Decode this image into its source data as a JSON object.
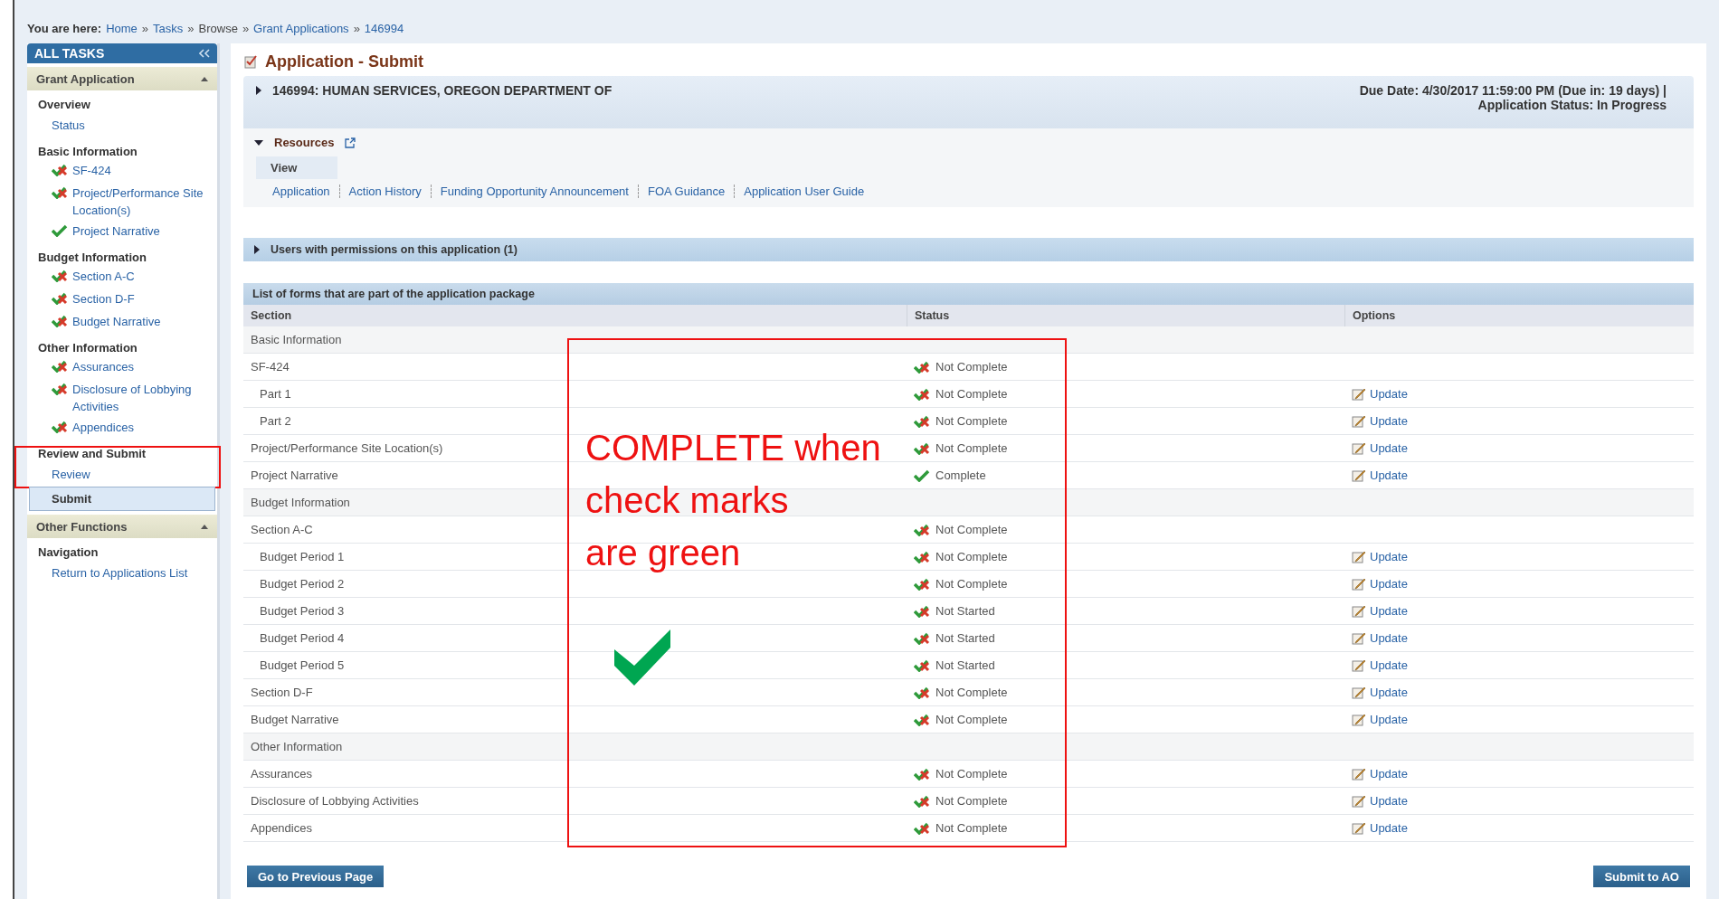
{
  "breadcrumb": {
    "label": "You are here:",
    "separator": "»",
    "items": [
      {
        "text": "Home",
        "link": true
      },
      {
        "text": "Tasks",
        "link": true
      },
      {
        "text": "Browse",
        "link": false
      },
      {
        "text": "Grant Applications",
        "link": true
      },
      {
        "text": "146994",
        "link": true
      }
    ]
  },
  "sidebar": {
    "title": "ALL TASKS",
    "groups": [
      {
        "title": "Grant Application",
        "expanded": true,
        "sections": [
          {
            "heading": "Overview",
            "items": [
              {
                "label": "Status",
                "kind": "link",
                "selected": false,
                "highlighted": false
              }
            ]
          },
          {
            "heading": "Basic Information",
            "items": [
              {
                "label": "SF-424",
                "kind": "form",
                "complete": false,
                "selected": false,
                "highlighted": false
              },
              {
                "label": "Project/Performance Site Location(s)",
                "kind": "form",
                "complete": false,
                "selected": false,
                "highlighted": false
              },
              {
                "label": "Project Narrative",
                "kind": "form",
                "complete": true,
                "selected": false,
                "highlighted": false
              }
            ]
          },
          {
            "heading": "Budget Information",
            "items": [
              {
                "label": "Section A-C",
                "kind": "form",
                "complete": false,
                "selected": false,
                "highlighted": false
              },
              {
                "label": "Section D-F",
                "kind": "form",
                "complete": false,
                "selected": false,
                "highlighted": false
              },
              {
                "label": "Budget Narrative",
                "kind": "form",
                "complete": false,
                "selected": false,
                "highlighted": false
              }
            ]
          },
          {
            "heading": "Other Information",
            "items": [
              {
                "label": "Assurances",
                "kind": "form",
                "complete": false,
                "selected": false,
                "highlighted": false
              },
              {
                "label": "Disclosure of Lobbying Activities",
                "kind": "form",
                "complete": false,
                "selected": false,
                "highlighted": false
              },
              {
                "label": "Appendices",
                "kind": "form",
                "complete": false,
                "selected": false,
                "highlighted": false
              }
            ]
          },
          {
            "heading": "Review and Submit",
            "items": [
              {
                "label": "Review",
                "kind": "link",
                "selected": false,
                "highlighted": true
              },
              {
                "label": "Submit",
                "kind": "link",
                "selected": true,
                "highlighted": false
              }
            ]
          }
        ]
      },
      {
        "title": "Other Functions",
        "expanded": true,
        "sections": [
          {
            "heading": "Navigation",
            "items": [
              {
                "label": "Return to Applications List",
                "kind": "link",
                "selected": false,
                "highlighted": false
              }
            ]
          }
        ]
      }
    ]
  },
  "page_title": "Application - Submit",
  "application": {
    "name": "146994: HUMAN SERVICES, OREGON DEPARTMENT OF",
    "due_date": "Due Date: 4/30/2017 11:59:00 PM (Due in: 19 days) |",
    "status": "Application Status: In Progress",
    "expanded": false
  },
  "resources": {
    "title": "Resources",
    "expanded": true,
    "tab": "View",
    "links": [
      "Application",
      "Action History",
      "Funding Opportunity Announcement",
      "FOA Guidance",
      "Application User Guide"
    ]
  },
  "users_panel": {
    "title": "Users with permissions on this application (1)",
    "expanded": false
  },
  "forms": {
    "title": "List of forms that are part of the application package",
    "columns": [
      "Section",
      "Status",
      "Options"
    ],
    "rows": [
      {
        "kind": "group",
        "section": "Basic Information"
      },
      {
        "kind": "form",
        "section": "SF-424",
        "status": "Not Complete",
        "complete": false
      },
      {
        "kind": "part",
        "section": "Part 1",
        "status": "Not Complete",
        "complete": false,
        "option": "Update"
      },
      {
        "kind": "part",
        "section": "Part 2",
        "status": "Not Complete",
        "complete": false,
        "option": "Update"
      },
      {
        "kind": "form",
        "section": "Project/Performance Site Location(s)",
        "status": "Not Complete",
        "complete": false,
        "option": "Update"
      },
      {
        "kind": "form",
        "section": "Project Narrative",
        "status": "Complete",
        "complete": true,
        "option": "Update"
      },
      {
        "kind": "group",
        "section": "Budget Information"
      },
      {
        "kind": "form",
        "section": "Section A-C",
        "status": "Not Complete",
        "complete": false
      },
      {
        "kind": "part",
        "section": "Budget Period 1",
        "status": "Not Complete",
        "complete": false,
        "option": "Update"
      },
      {
        "kind": "part",
        "section": "Budget Period 2",
        "status": "Not Complete",
        "complete": false,
        "option": "Update"
      },
      {
        "kind": "part",
        "section": "Budget Period 3",
        "status": "Not Started",
        "complete": false,
        "option": "Update"
      },
      {
        "kind": "part",
        "section": "Budget Period 4",
        "status": "Not Started",
        "complete": false,
        "option": "Update"
      },
      {
        "kind": "part",
        "section": "Budget Period 5",
        "status": "Not Started",
        "complete": false,
        "option": "Update"
      },
      {
        "kind": "form",
        "section": "Section D-F",
        "status": "Not Complete",
        "complete": false,
        "option": "Update"
      },
      {
        "kind": "form",
        "section": "Budget Narrative",
        "status": "Not Complete",
        "complete": false,
        "option": "Update"
      },
      {
        "kind": "group",
        "section": "Other Information"
      },
      {
        "kind": "form",
        "section": "Assurances",
        "status": "Not Complete",
        "complete": false,
        "option": "Update"
      },
      {
        "kind": "form",
        "section": "Disclosure of Lobbying Activities",
        "status": "Not Complete",
        "complete": false,
        "option": "Update"
      },
      {
        "kind": "form",
        "section": "Appendices",
        "status": "Not Complete",
        "complete": false,
        "option": "Update"
      }
    ]
  },
  "annotation": {
    "lines": [
      "COMPLETE when",
      "check marks",
      "are green"
    ]
  },
  "buttons": {
    "previous": "Go to Previous Page",
    "submit": "Submit to AO"
  }
}
